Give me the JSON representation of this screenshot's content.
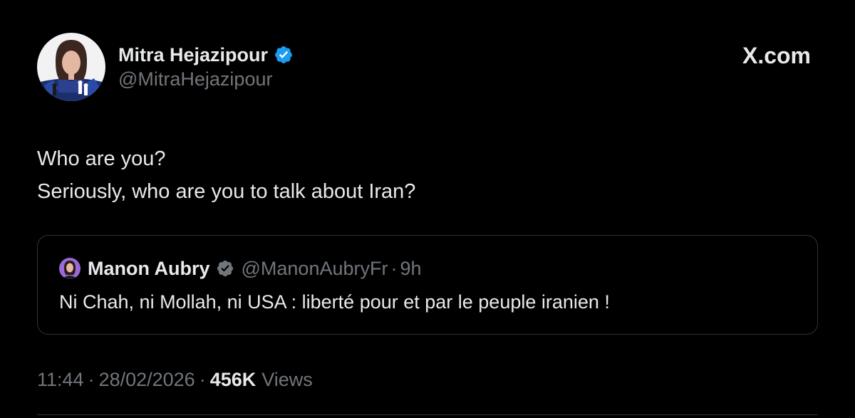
{
  "tweet": {
    "author": {
      "name": "Mitra Hejazipour",
      "handle": "@MitraHejazipour",
      "verified": true,
      "avatar_icon": "user-avatar"
    },
    "site_label": "X.com",
    "text_lines": [
      "Who are you?",
      "Seriously, who are you to talk about Iran?"
    ],
    "quoted": {
      "name": "Manon Aubry",
      "handle": "@ManonAubryFr",
      "separator": "·",
      "time": "9h",
      "verified": true,
      "text": "Ni Chah, ni Mollah, ni USA : liberté pour et par le peuple iranien !"
    },
    "meta": {
      "time": "11:44",
      "separator": "·",
      "date": "28/02/2026",
      "views_count": "456K",
      "views_label": "Views"
    }
  },
  "colors": {
    "background": "#000000",
    "text_primary": "#e7e9ea",
    "text_secondary": "#71767b",
    "verified_blue": "#1d9bf0",
    "border": "#2f3336"
  }
}
